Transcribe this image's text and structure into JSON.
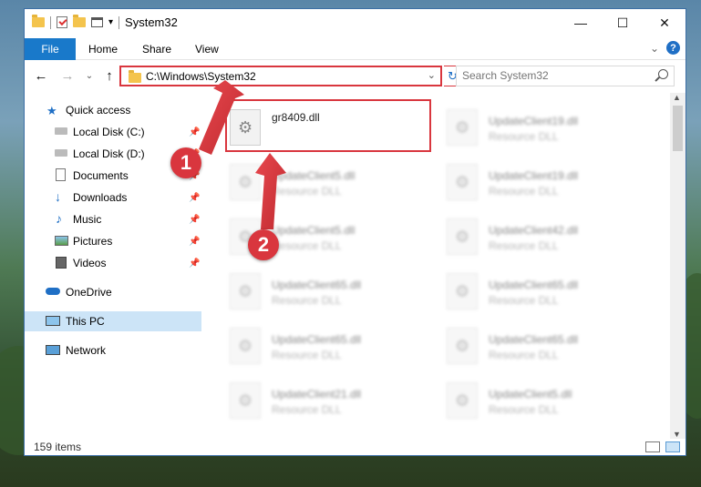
{
  "window": {
    "title": "System32",
    "minimize_glyph": "—",
    "maximize_glyph": "☐",
    "close_glyph": "✕"
  },
  "ribbon": {
    "tabs": [
      "File",
      "Home",
      "Share",
      "View"
    ],
    "collapse_glyph": "⌄",
    "help_glyph": "?"
  },
  "nav": {
    "back_glyph": "←",
    "forward_glyph": "→",
    "recent_glyph": "⌄",
    "up_glyph": "↑",
    "address": "C:\\Windows\\System32",
    "address_chevron": "⌄",
    "refresh_glyph": "↻",
    "search_placeholder": "Search System32"
  },
  "sidebar": {
    "items": [
      {
        "label": "Quick access",
        "icon": "star-icon"
      },
      {
        "label": "Local Disk (C:)",
        "icon": "drive-icon",
        "pinned": true
      },
      {
        "label": "Local Disk (D:)",
        "icon": "drive-icon",
        "pinned": true
      },
      {
        "label": "Documents",
        "icon": "documents-icon",
        "pinned": true
      },
      {
        "label": "Downloads",
        "icon": "download-icon",
        "pinned": true
      },
      {
        "label": "Music",
        "icon": "music-icon",
        "pinned": true
      },
      {
        "label": "Pictures",
        "icon": "pictures-icon",
        "pinned": true
      },
      {
        "label": "Videos",
        "icon": "videos-icon",
        "pinned": true
      },
      {
        "label": "OneDrive",
        "icon": "cloud-icon"
      },
      {
        "label": "This PC",
        "icon": "computer-icon",
        "selected": true
      },
      {
        "label": "Network",
        "icon": "network-icon"
      }
    ],
    "pin_glyph": "📌"
  },
  "files": [
    {
      "name": "gr8409.dll",
      "type": ""
    },
    {
      "name": "UpdateClient19.dll",
      "type": "Resource DLL"
    },
    {
      "name": "UpdateClient5.dll",
      "type": "Resource DLL"
    },
    {
      "name": "UpdateClient19.dll",
      "type": "Resource DLL"
    },
    {
      "name": "UpdateClient5.dll",
      "type": "Resource DLL"
    },
    {
      "name": "UpdateClient42.dll",
      "type": "Resource DLL"
    },
    {
      "name": "UpdateClient65.dll",
      "type": "Resource DLL"
    },
    {
      "name": "UpdateClient65.dll",
      "type": "Resource DLL"
    },
    {
      "name": "UpdateClient65.dll",
      "type": "Resource DLL"
    },
    {
      "name": "UpdateClient65.dll",
      "type": "Resource DLL"
    },
    {
      "name": "UpdateClient21.dll",
      "type": "Resource DLL"
    },
    {
      "name": "UpdateClient5.dll",
      "type": "Resource DLL"
    }
  ],
  "status": {
    "items_count": "159 items"
  },
  "annotations": {
    "step1": "1",
    "step2": "2",
    "highlight_color": "#d9363e"
  },
  "colors": {
    "accent": "#1979ca",
    "selection": "#cce4f7"
  }
}
